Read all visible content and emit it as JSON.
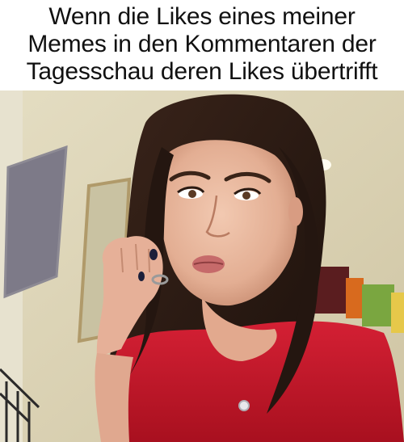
{
  "caption": {
    "lines": [
      "Wenn die Likes eines meiner",
      "Memes in den Kommentaren der",
      "Tagesschau deren Likes übertrifft"
    ]
  },
  "photo": {
    "subject": "woman-in-red-top-pouting",
    "colors": {
      "wall": "#d9d2b6",
      "hair": "#2a1a14",
      "skin": "#e9b9a0",
      "top": "#c2182c",
      "frame_painting": "#b09a6a"
    }
  }
}
